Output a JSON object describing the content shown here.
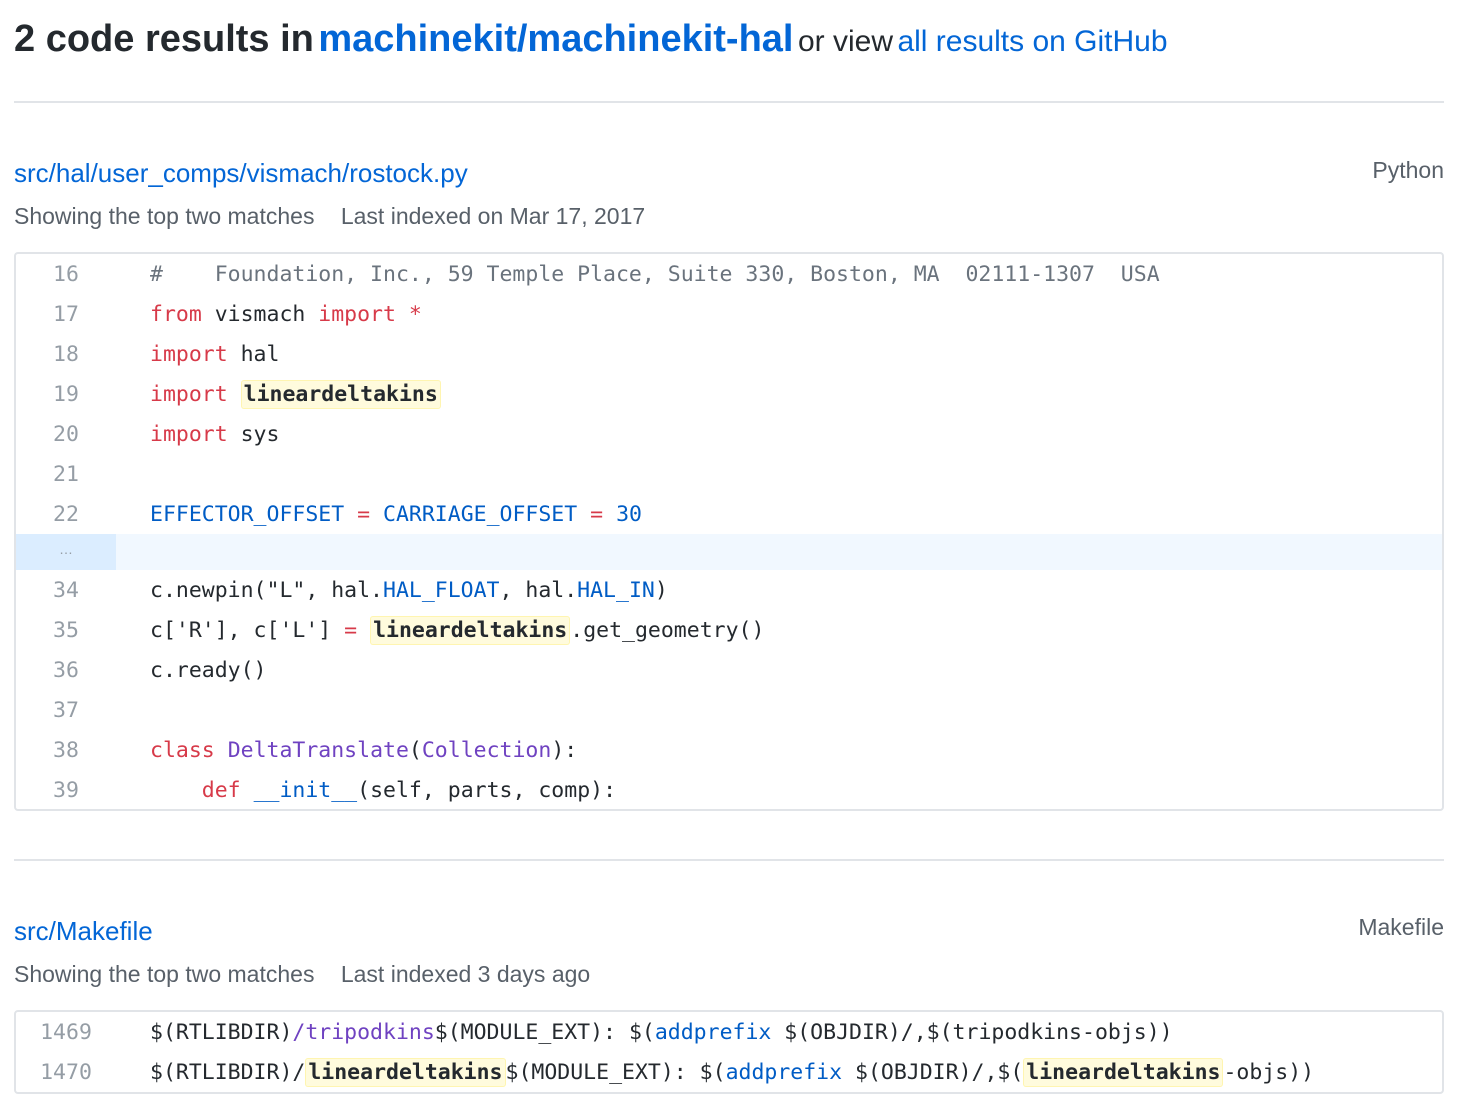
{
  "header": {
    "count_text": "2 code results in",
    "repo": "machinekit/machinekit-hal",
    "or_view": "or view",
    "all_results_link": "all results on GitHub"
  },
  "results": [
    {
      "path": "src/hal/user_comps/vismach/rostock.py",
      "language": "Python",
      "matches_text": "Showing the top two matches",
      "indexed_text": "Last indexed on Mar 17, 2017",
      "lines": [
        {
          "num": "16",
          "tokens": [
            [
              "c",
              "#    Foundation, Inc., 59 Temple Place, Suite 330, Boston, MA  02111-1307  USA"
            ]
          ]
        },
        {
          "num": "17",
          "tokens": [
            [
              "k",
              "from"
            ],
            [
              "p",
              " vismach "
            ],
            [
              "k",
              "import"
            ],
            [
              "p",
              " "
            ],
            [
              "k",
              "*"
            ]
          ]
        },
        {
          "num": "18",
          "tokens": [
            [
              "k",
              "import"
            ],
            [
              "p",
              " hal"
            ]
          ]
        },
        {
          "num": "19",
          "tokens": [
            [
              "k",
              "import"
            ],
            [
              "p",
              " "
            ],
            [
              "m",
              "lineardeltakins"
            ]
          ]
        },
        {
          "num": "20",
          "tokens": [
            [
              "k",
              "import"
            ],
            [
              "p",
              " sys"
            ]
          ]
        },
        {
          "num": "21",
          "tokens": [
            [
              "p",
              ""
            ]
          ]
        },
        {
          "num": "22",
          "tokens": [
            [
              "b",
              "EFFECTOR_OFFSET"
            ],
            [
              "p",
              " "
            ],
            [
              "k",
              "="
            ],
            [
              "p",
              " "
            ],
            [
              "b",
              "CARRIAGE_OFFSET"
            ],
            [
              "p",
              " "
            ],
            [
              "k",
              "="
            ],
            [
              "p",
              " "
            ],
            [
              "b",
              "30"
            ]
          ]
        },
        {
          "sep": true,
          "num": "…"
        },
        {
          "num": "34",
          "tokens": [
            [
              "p",
              "c.newpin(\"L\", hal."
            ],
            [
              "b",
              "HAL_FLOAT"
            ],
            [
              "p",
              ", hal."
            ],
            [
              "b",
              "HAL_IN"
            ],
            [
              "p",
              ")"
            ]
          ]
        },
        {
          "num": "35",
          "tokens": [
            [
              "p",
              "c['R'], c['L'] "
            ],
            [
              "k",
              "="
            ],
            [
              "p",
              " "
            ],
            [
              "m",
              "lineardeltakins"
            ],
            [
              "p",
              ".get_geometry()"
            ]
          ]
        },
        {
          "num": "36",
          "tokens": [
            [
              "p",
              "c.ready()"
            ]
          ]
        },
        {
          "num": "37",
          "tokens": [
            [
              "p",
              ""
            ]
          ]
        },
        {
          "num": "38",
          "tokens": [
            [
              "k",
              "class"
            ],
            [
              "p",
              " "
            ],
            [
              "t",
              "DeltaTranslate"
            ],
            [
              "p",
              "("
            ],
            [
              "t",
              "Collection"
            ],
            [
              "p",
              "):"
            ]
          ]
        },
        {
          "num": "39",
          "tokens": [
            [
              "p",
              "    "
            ],
            [
              "k",
              "def"
            ],
            [
              "p",
              " "
            ],
            [
              "b",
              "__init__"
            ],
            [
              "p",
              "(self, parts, comp):"
            ]
          ]
        }
      ]
    },
    {
      "path": "src/Makefile",
      "language": "Makefile",
      "matches_text": "Showing the top two matches",
      "indexed_text": "Last indexed 3 days ago",
      "lines": [
        {
          "num": "1469",
          "tokens": [
            [
              "p",
              "$(RTLIBDIR)"
            ],
            [
              "t",
              "/tripodkins"
            ],
            [
              "p",
              "$(MODULE_EXT): $("
            ],
            [
              "b",
              "addprefix"
            ],
            [
              "p",
              " $(OBJDIR)/,$(tripodkins-objs))"
            ]
          ]
        },
        {
          "num": "1470",
          "tokens": [
            [
              "p",
              "$(RTLIBDIR)/"
            ],
            [
              "m",
              "lineardeltakins"
            ],
            [
              "p",
              "$(MODULE_EXT): $("
            ],
            [
              "b",
              "addprefix"
            ],
            [
              "p",
              " $(OBJDIR)/,$("
            ],
            [
              "m",
              "lineardeltakins"
            ],
            [
              "p",
              "-objs))"
            ]
          ]
        }
      ]
    }
  ]
}
